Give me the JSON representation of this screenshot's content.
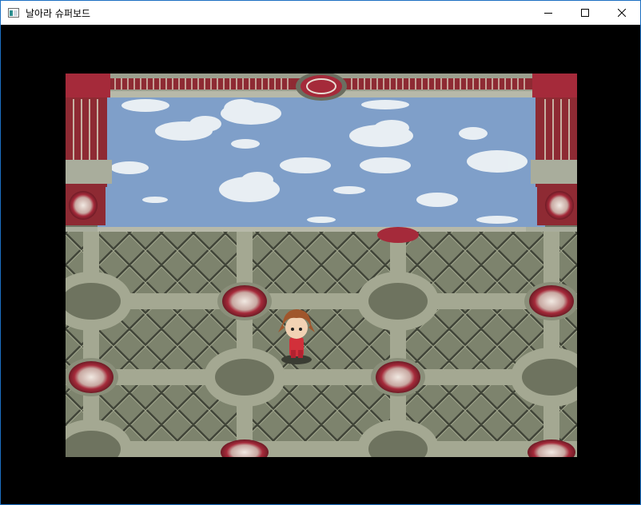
{
  "window": {
    "title": "날아라 슈퍼보드",
    "controls": {
      "minimize_icon": "minimize-icon",
      "maximize_icon": "maximize-icon",
      "close_icon": "close-icon"
    }
  },
  "game": {
    "scene": "palace-courtyard",
    "colors": {
      "sky": "#7f9fc9",
      "floor_tile": "#8a9077",
      "floor_dark": "#4f5445",
      "medallion_red": "#a52a3a",
      "pillar_red": "#8e2a33",
      "stone": "#a9ad9c"
    }
  }
}
